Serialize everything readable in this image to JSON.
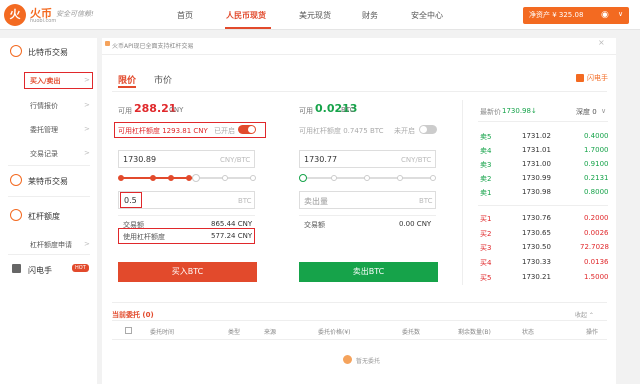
{
  "header": {
    "logo_text": "火币",
    "logo_glyph": "火",
    "brand_sub": "huobi.com",
    "slogan": "安全可信赖!",
    "nav": [
      "首页",
      "人民币现货",
      "美元现货",
      "财务",
      "安全中心"
    ],
    "active_nav": 1,
    "asset_label": "净资产 ¥ 325.08",
    "eye_icon": "eye-icon",
    "caret": "∨"
  },
  "sidebar": {
    "sections": [
      {
        "icon": "bitcoin-icon",
        "label": "比特币交易"
      },
      {
        "icon": "litecoin-icon",
        "label": "莱特币交易"
      },
      {
        "icon": "leverage-icon",
        "label": "杠杆额度"
      },
      {
        "icon": "flash-icon",
        "label": "闪电手"
      }
    ],
    "items": [
      "买入/卖出",
      "行情报价",
      "委托管理",
      "交易记录",
      "杠杆额度申请"
    ],
    "badge": "HOT",
    "arrow": ">"
  },
  "notice": {
    "text": "火币API现已全面支持杠杆交易",
    "close": "×"
  },
  "tabs": [
    "限价",
    "市价"
  ],
  "flash_label": "闪电手",
  "buy": {
    "avail_label": "可用",
    "avail_value": "288.21",
    "avail_unit": "CNY",
    "leverage_label": "可用杠杆额度 1293.81 CNY",
    "leverage_state": "已开启",
    "price": "1730.89",
    "price_unit": "CNY/BTC",
    "amount": "0.5",
    "amount_unit": "BTC",
    "total_label": "交易额",
    "total_value": "865.44 CNY",
    "used_label": "使用杠杆额度",
    "used_value": "577.24 CNY",
    "button": "买入BTC"
  },
  "sell": {
    "avail_label": "可用",
    "avail_value": "0.0213",
    "avail_unit": "BTC",
    "leverage_label": "可用杠杆额度 0.7475 BTC",
    "leverage_state": "未开启",
    "price": "1730.77",
    "price_unit": "CNY/BTC",
    "amount_placeholder": "卖出量",
    "amount_unit": "BTC",
    "total_label": "交易额",
    "total_value": "0.00 CNY",
    "button": "卖出BTC"
  },
  "orderbook": {
    "latest_label": "最新价",
    "latest_value": "1730.98↓",
    "depth_label": "深度 0",
    "depth_caret": "∨",
    "asks": [
      {
        "label": "卖5",
        "price": "1731.02",
        "amount": "0.4000"
      },
      {
        "label": "卖4",
        "price": "1731.01",
        "amount": "1.7000"
      },
      {
        "label": "卖3",
        "price": "1731.00",
        "amount": "0.9100"
      },
      {
        "label": "卖2",
        "price": "1730.99",
        "amount": "0.2131"
      },
      {
        "label": "卖1",
        "price": "1730.98",
        "amount": "0.8000"
      }
    ],
    "bids": [
      {
        "label": "买1",
        "price": "1730.76",
        "amount": "0.2000"
      },
      {
        "label": "买2",
        "price": "1730.65",
        "amount": "0.0026"
      },
      {
        "label": "买3",
        "price": "1730.50",
        "amount": "72.7028"
      },
      {
        "label": "买4",
        "price": "1730.33",
        "amount": "0.0136"
      },
      {
        "label": "买5",
        "price": "1730.21",
        "amount": "1.5000"
      }
    ]
  },
  "orders": {
    "title": "当前委托 (0)",
    "collapse": "收起 ⌃",
    "columns": [
      "委托时间",
      "类型",
      "来源",
      "委托价格(¥)",
      "委托数",
      "剩余数量(B)",
      "状态",
      "操作"
    ],
    "empty": "暂无委托"
  },
  "colors": {
    "accent": "#e24a2c",
    "buy_button": "#e24a2c",
    "sell_button": "#16a34a",
    "highlight_box": "#e0282b",
    "ask_color": "#16a34a",
    "bid_color": "#e0282b"
  }
}
